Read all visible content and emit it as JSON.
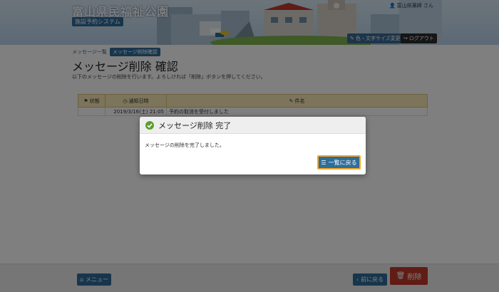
{
  "header": {
    "title": "富山県民福祉公園",
    "system_badge": "施設予約システム",
    "user": "富山県薬師 さん",
    "font_button": "色・文字サイズ変更",
    "logout_button": "ログアウト"
  },
  "breadcrumb": {
    "items": [
      "メッセージ一覧",
      "メッセージ削除確認"
    ]
  },
  "page": {
    "title": "メッセージ削除 確認",
    "description": "以下のメッセージの削除を行います。よろしければ「削除」ボタンを押してください。"
  },
  "table": {
    "headers": [
      "状態",
      "通知日時",
      "件名"
    ],
    "rows": [
      [
        "",
        "2019/3/16(土) 21:05",
        "予約の取消を受付しました"
      ]
    ]
  },
  "footer": {
    "menu_button": "メニュー",
    "back_button": "前に戻る",
    "delete_button": "削除"
  },
  "modal": {
    "title": "メッセージ削除 完了",
    "message": "メッセージの削除を完了しました。",
    "button": "一覧に戻る"
  },
  "colors": {
    "primary": "#2f6d9b",
    "danger": "#c0392b",
    "success": "#5aa02c",
    "table_header": "#f8e9b6"
  }
}
